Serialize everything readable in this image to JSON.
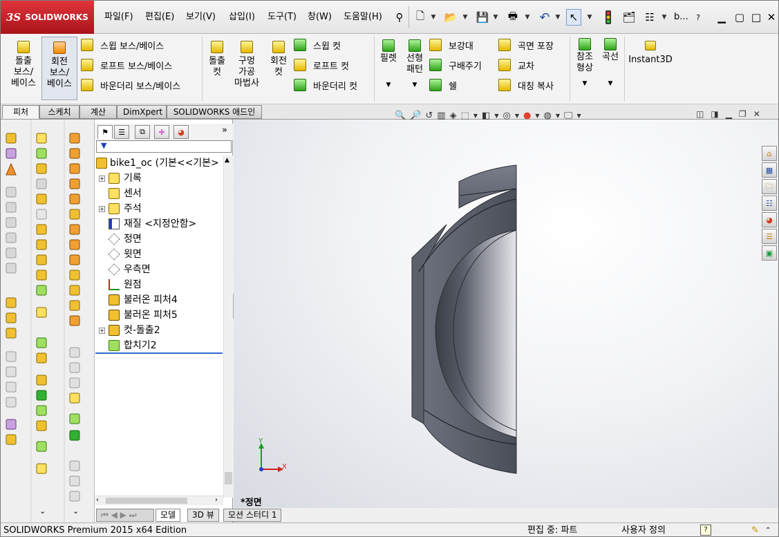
{
  "app": {
    "logo_text": "SOLIDWORKS",
    "logo_mark": "3S"
  },
  "menu": [
    "파일(F)",
    "편집(E)",
    "보기(V)",
    "삽입(I)",
    "도구(T)",
    "창(W)",
    "도움말(H)"
  ],
  "title_fragment": "b...",
  "ribbon": {
    "extrude_boss": [
      "돌출",
      "보스/",
      "베이스"
    ],
    "revolve_boss": [
      "회전",
      "보스/",
      "베이스"
    ],
    "swept_boss": "스윕 보스/베이스",
    "loft_boss": "로프트 보스/베이스",
    "boundary_boss": "바운더리 보스/베이스",
    "extrude_cut": [
      "돌출",
      "컷"
    ],
    "hole_wizard": [
      "구멍",
      "가공",
      "마법사"
    ],
    "revolve_cut": [
      "회전",
      "컷"
    ],
    "swept_cut": "스윕 컷",
    "loft_cut": "로프트 컷",
    "boundary_cut": "바운더리 컷",
    "fillet": "필렛",
    "linear_pattern": [
      "선형",
      "패턴"
    ],
    "rib": "보강대",
    "draft": "구배주기",
    "shell": "쉘",
    "wrap": "곡면 포장",
    "intersect": "교차",
    "mirror": "대칭 복사",
    "ref_geometry": [
      "참조",
      "형상"
    ],
    "curves": "곡선",
    "instant3d": "Instant3D"
  },
  "tabs": [
    "피처",
    "스케치",
    "계산",
    "DimXpert",
    "SOLIDWORKS 애드인"
  ],
  "tree": {
    "root": "bike1_oc  (기본<<기본>",
    "nodes": [
      {
        "label": "기록",
        "expand": "+",
        "icon": "history-icon"
      },
      {
        "label": "센서",
        "expand": "",
        "icon": "sensor-icon"
      },
      {
        "label": "주석",
        "expand": "+",
        "icon": "annotation-icon"
      },
      {
        "label": "재질 <지정안함>",
        "expand": "",
        "icon": "material-icon"
      },
      {
        "label": "정면",
        "expand": "",
        "icon": "plane-icon"
      },
      {
        "label": "윗면",
        "expand": "",
        "icon": "plane-icon"
      },
      {
        "label": "우측면",
        "expand": "",
        "icon": "plane-icon"
      },
      {
        "label": "원점",
        "expand": "",
        "icon": "origin-icon"
      },
      {
        "label": "불러온 피처4",
        "expand": "",
        "icon": "imported-feature-icon"
      },
      {
        "label": "불러온 피처5",
        "expand": "",
        "icon": "imported-feature-icon"
      },
      {
        "label": "컷-돌출2",
        "expand": "+",
        "icon": "cut-extrude-icon"
      },
      {
        "label": "합치기2",
        "expand": "",
        "icon": "combine-icon"
      }
    ]
  },
  "bottom_tabs": [
    "모델",
    "3D 뷰",
    "모션 스터디 1"
  ],
  "viewport": {
    "view_label": "*정면",
    "axis_x": "X",
    "axis_y": "Y"
  },
  "status": {
    "edition": "SOLIDWORKS Premium 2015 x64 Edition",
    "mode": "편집 중: 파트",
    "custom": "사용자 정의"
  },
  "colors": {
    "accent": "#c8202a",
    "model": "#565a66"
  }
}
